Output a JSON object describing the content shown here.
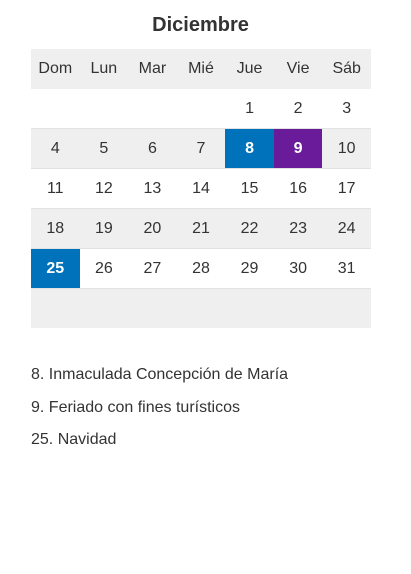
{
  "calendar": {
    "month": "Diciembre",
    "weekdays": [
      "Dom",
      "Lun",
      "Mar",
      "Mié",
      "Jue",
      "Vie",
      "Sáb"
    ],
    "weeks": [
      [
        "",
        "",
        "",
        "",
        "1",
        "2",
        "3"
      ],
      [
        "4",
        "5",
        "6",
        "7",
        "8",
        "9",
        "10"
      ],
      [
        "11",
        "12",
        "13",
        "14",
        "15",
        "16",
        "17"
      ],
      [
        "18",
        "19",
        "20",
        "21",
        "22",
        "23",
        "24"
      ],
      [
        "25",
        "26",
        "27",
        "28",
        "29",
        "30",
        "31"
      ],
      [
        "",
        "",
        "",
        "",
        "",
        "",
        ""
      ]
    ],
    "highlights": [
      {
        "day": "8",
        "color": "#0072bb"
      },
      {
        "day": "9",
        "color": "#6a1b9a"
      },
      {
        "day": "25",
        "color": "#0072bb"
      }
    ]
  },
  "holidays": [
    "8. Inmaculada Concepción de María",
    "9. Feriado con fines turísticos",
    "25. Navidad"
  ],
  "colors": {
    "blue": "#0072bb",
    "purple": "#6a1b9a",
    "stripe": "#efefef",
    "text": "#333333"
  }
}
